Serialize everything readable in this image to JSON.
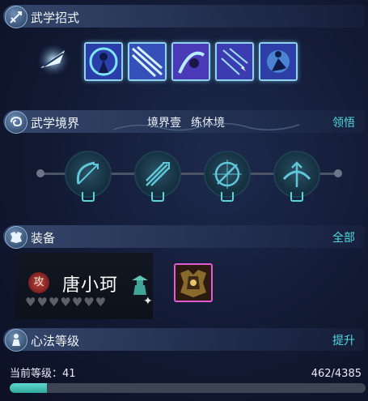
{
  "sections": {
    "skills": {
      "title": "武学招式"
    },
    "realm": {
      "title": "武学境界",
      "realm_level": "境界壹",
      "realm_name": "练体境",
      "action": "领悟"
    },
    "equipment": {
      "title": "装备",
      "action": "全部"
    },
    "mind_art": {
      "title": "心法等级",
      "action": "提升"
    }
  },
  "skill_icons": [
    "feather-dart-icon",
    "dancer-slash-icon",
    "triple-blade-icon",
    "spin-kick-icon",
    "arrow-rain-icon",
    "lunge-strike-icon"
  ],
  "realm_nodes": [
    "bow-arrow-icon",
    "multi-arrow-icon",
    "compass-arrow-icon",
    "aim-arrow-icon"
  ],
  "character": {
    "badge": "攻",
    "name": "唐小珂",
    "hearts": "♥♥♥♥♥♥♥",
    "hearts_filled": 0,
    "hearts_total": 7
  },
  "level": {
    "label": "当前等级：41",
    "exp": "462/4385",
    "current": 462,
    "max": 4385
  },
  "colors": {
    "accent": "#4fd8e0",
    "equip_border": "#e25bd4",
    "progress": "#3fbfb0"
  }
}
